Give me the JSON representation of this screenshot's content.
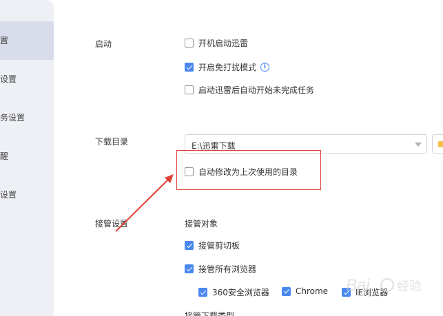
{
  "sidebar": {
    "items": [
      {
        "label": "设置"
      },
      {
        "label": "下载设置"
      },
      {
        "label": "任务设置"
      },
      {
        "label": "提醒"
      },
      {
        "label": "高级设置"
      }
    ]
  },
  "startup": {
    "label": "启动",
    "options": [
      {
        "label": "开机启动迅雷",
        "checked": false
      },
      {
        "label": "开启免打扰模式",
        "checked": true
      },
      {
        "label": "启动迅雷后自动开始未完成任务",
        "checked": false
      }
    ]
  },
  "download_dir": {
    "label": "下载目录",
    "path": "E:\\迅雷下载",
    "auto_change_label": "自动修改为上次使用的目录",
    "auto_change_checked": false
  },
  "takeover": {
    "label": "接管设置",
    "target_label": "接管对象",
    "clipboard_label": "接管剪切板",
    "clipboard_checked": true,
    "all_browsers_label": "接管所有浏览器",
    "all_browsers_checked": true,
    "browsers": [
      {
        "label": "360安全浏览器",
        "checked": true
      },
      {
        "label": "Chrome",
        "checked": true
      },
      {
        "label": "IE浏览器",
        "checked": true
      }
    ],
    "download_type_label": "接管下载类型"
  },
  "colors": {
    "accent": "#4a88f0",
    "annotation": "#e0403a",
    "sidebar_bg": "#eef0f5",
    "sidebar_active": "#d9dceb"
  }
}
